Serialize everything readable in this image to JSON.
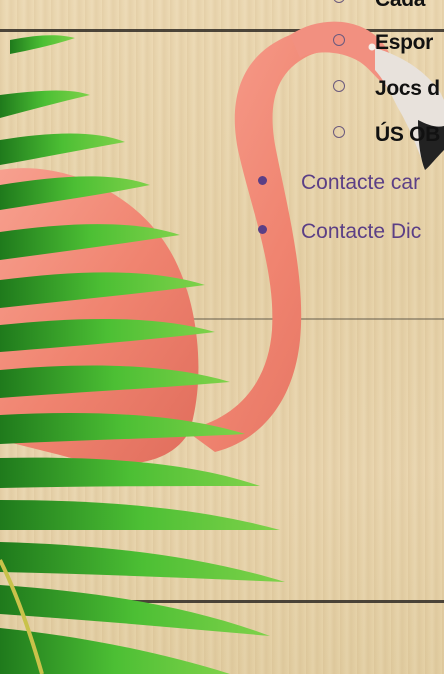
{
  "menu": {
    "sub_items": [
      {
        "label": "Cada"
      },
      {
        "label": "Espor"
      },
      {
        "label": "Jocs d"
      },
      {
        "label": "ÚS OB"
      }
    ],
    "main_items": [
      {
        "label": "Contacte car"
      },
      {
        "label": "Contacte Dic"
      }
    ]
  },
  "colors": {
    "menu_link": "#5b3f86",
    "sub_item_text": "#111111",
    "plank_line": "#2f2a24",
    "flamingo": "#f08a78",
    "palm_leaf": "#3aa52b"
  },
  "icons": {
    "sub_bullet": "hollow-circle-bullet-icon",
    "main_bullet": "filled-dot-bullet-icon"
  }
}
